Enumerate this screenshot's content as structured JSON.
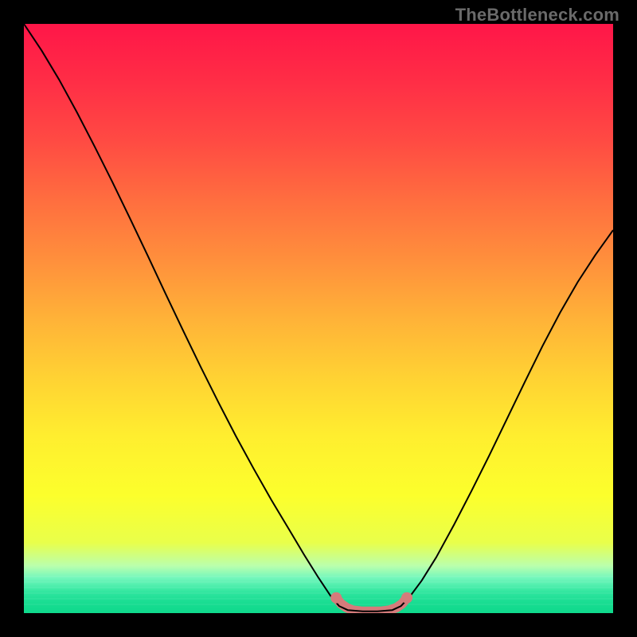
{
  "branding": "TheBottleneck.com",
  "chart_data": {
    "type": "line",
    "title": "",
    "xlabel": "",
    "ylabel": "",
    "xlim": [
      0,
      1
    ],
    "ylim": [
      0,
      1
    ],
    "background": {
      "kind": "vertical-gradient",
      "stops": [
        {
          "y": 0.0,
          "color": "#ff1648"
        },
        {
          "y": 0.1,
          "color": "#ff2e46"
        },
        {
          "y": 0.2,
          "color": "#ff4b43"
        },
        {
          "y": 0.3,
          "color": "#ff6e3f"
        },
        {
          "y": 0.4,
          "color": "#ff8f3c"
        },
        {
          "y": 0.5,
          "color": "#ffb238"
        },
        {
          "y": 0.6,
          "color": "#ffd233"
        },
        {
          "y": 0.7,
          "color": "#ffee2f"
        },
        {
          "y": 0.8,
          "color": "#fcff2c"
        },
        {
          "y": 0.88,
          "color": "#e9ff4a"
        },
        {
          "y": 0.92,
          "color": "#baffad"
        },
        {
          "y": 0.94,
          "color": "#74f7bc"
        },
        {
          "y": 0.955,
          "color": "#4bedab"
        },
        {
          "y": 0.965,
          "color": "#2fe59e"
        },
        {
          "y": 0.975,
          "color": "#21e097"
        },
        {
          "y": 0.985,
          "color": "#16dc90"
        },
        {
          "y": 1.0,
          "color": "#0fd98c"
        }
      ]
    },
    "series": [
      {
        "name": "bottleneck-curve",
        "color": "#000000",
        "width": 2,
        "points": [
          {
            "x": 0.0,
            "y": 1.0
          },
          {
            "x": 0.03,
            "y": 0.955
          },
          {
            "x": 0.06,
            "y": 0.905
          },
          {
            "x": 0.09,
            "y": 0.85
          },
          {
            "x": 0.12,
            "y": 0.792
          },
          {
            "x": 0.15,
            "y": 0.732
          },
          {
            "x": 0.18,
            "y": 0.67
          },
          {
            "x": 0.21,
            "y": 0.607
          },
          {
            "x": 0.24,
            "y": 0.543
          },
          {
            "x": 0.27,
            "y": 0.48
          },
          {
            "x": 0.3,
            "y": 0.418
          },
          {
            "x": 0.33,
            "y": 0.358
          },
          {
            "x": 0.36,
            "y": 0.3
          },
          {
            "x": 0.39,
            "y": 0.245
          },
          {
            "x": 0.42,
            "y": 0.192
          },
          {
            "x": 0.45,
            "y": 0.142
          },
          {
            "x": 0.475,
            "y": 0.1
          },
          {
            "x": 0.5,
            "y": 0.06
          },
          {
            "x": 0.52,
            "y": 0.03
          },
          {
            "x": 0.535,
            "y": 0.012
          },
          {
            "x": 0.55,
            "y": 0.005
          },
          {
            "x": 0.575,
            "y": 0.003
          },
          {
            "x": 0.6,
            "y": 0.003
          },
          {
            "x": 0.625,
            "y": 0.005
          },
          {
            "x": 0.64,
            "y": 0.012
          },
          {
            "x": 0.655,
            "y": 0.028
          },
          {
            "x": 0.675,
            "y": 0.055
          },
          {
            "x": 0.7,
            "y": 0.095
          },
          {
            "x": 0.73,
            "y": 0.15
          },
          {
            "x": 0.76,
            "y": 0.208
          },
          {
            "x": 0.79,
            "y": 0.268
          },
          {
            "x": 0.82,
            "y": 0.33
          },
          {
            "x": 0.85,
            "y": 0.392
          },
          {
            "x": 0.88,
            "y": 0.453
          },
          {
            "x": 0.91,
            "y": 0.51
          },
          {
            "x": 0.94,
            "y": 0.562
          },
          {
            "x": 0.97,
            "y": 0.608
          },
          {
            "x": 1.0,
            "y": 0.65
          }
        ]
      },
      {
        "name": "optimal-range-marker",
        "color": "#d57b7b",
        "width": 12,
        "linecap": "round",
        "points": [
          {
            "x": 0.53,
            "y": 0.026
          },
          {
            "x": 0.538,
            "y": 0.016
          },
          {
            "x": 0.548,
            "y": 0.009
          },
          {
            "x": 0.558,
            "y": 0.005
          },
          {
            "x": 0.575,
            "y": 0.003
          },
          {
            "x": 0.59,
            "y": 0.003
          },
          {
            "x": 0.605,
            "y": 0.003
          },
          {
            "x": 0.62,
            "y": 0.005
          },
          {
            "x": 0.632,
            "y": 0.009
          },
          {
            "x": 0.642,
            "y": 0.016
          },
          {
            "x": 0.65,
            "y": 0.026
          }
        ]
      }
    ]
  }
}
